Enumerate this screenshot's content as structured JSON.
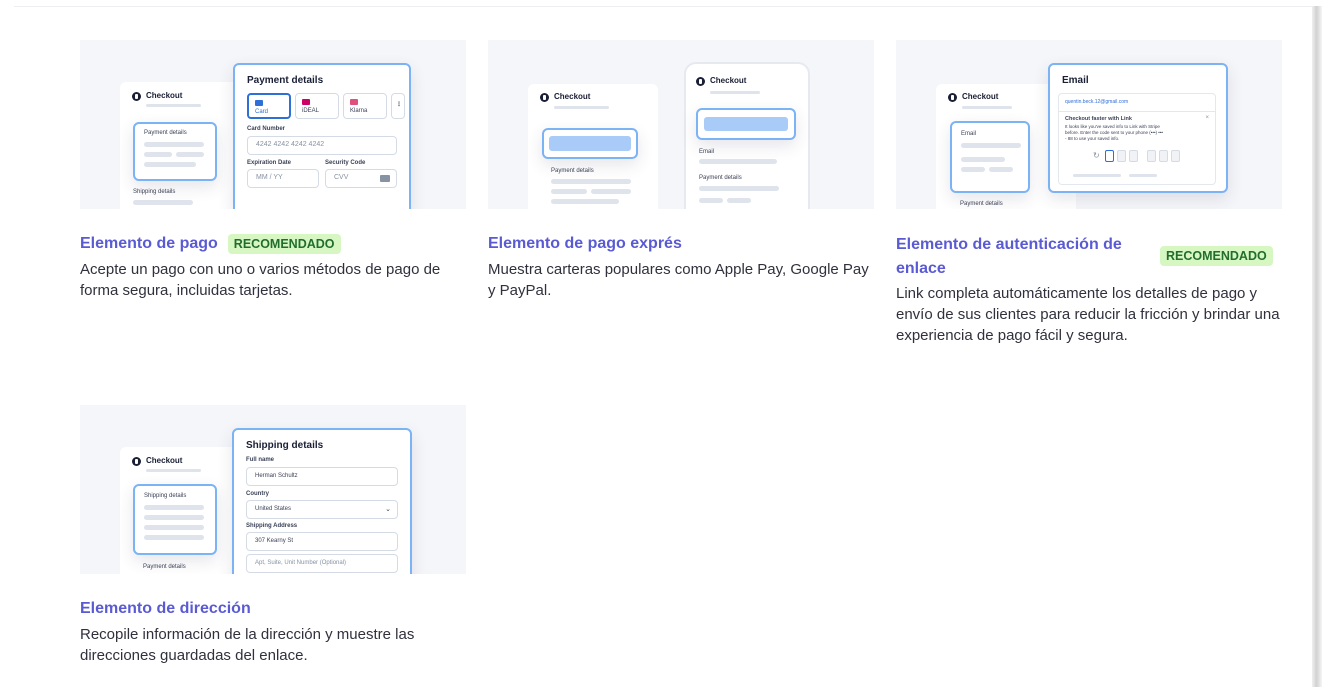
{
  "colors": {
    "title": "#5a5bd3",
    "badge_text": "#226d2d",
    "badge_bg": "#d7f7c2",
    "accent_blue": "#7cb3f5"
  },
  "cards": [
    {
      "title": "Elemento de pago",
      "badge": "RECOMENDADO",
      "description": "Acepte un pago con uno o varios métodos de pago de forma segura, incluidas tarjetas.",
      "preview": {
        "checkout": "Checkout",
        "section_payment": "Payment details",
        "section_shipping": "Shipping details",
        "panel_title": "Payment details",
        "tabs": [
          "Card",
          "iDEAL",
          "Klarna"
        ],
        "card_number_label": "Card Number",
        "card_number_value": "4242 4242 4242 4242",
        "expiration_label": "Expiration Date",
        "expiration_placeholder": "MM / YY",
        "security_label": "Security Code",
        "security_placeholder": "CVV"
      }
    },
    {
      "title": "Elemento de pago exprés",
      "description": "Muestra carteras populares como Apple Pay, Google Pay y PayPal.",
      "preview": {
        "checkout": "Checkout",
        "phone_checkout": "Checkout",
        "section_payment": "Payment details",
        "email_label": "Email",
        "phone_payment": "Payment details"
      }
    },
    {
      "title": "Elemento de autenticación de enlace",
      "badge": "RECOMENDADO",
      "description": "Link completa automáticamente los detalles de pago y envío de sus clientes para reducir la fricción y brindar una experiencia de pago fácil y segura.",
      "preview": {
        "checkout": "Checkout",
        "section_email": "Email",
        "section_payment": "Payment details",
        "panel_title": "Email",
        "email_value": "quentin.beck.12@gmail.com",
        "link_title": "Checkout faster with Link",
        "link_text_1": "It looks like you've saved info to Link with Stripe",
        "link_text_2": "before. Enter the code sent to your phone (•••) •••",
        "link_text_3": "- 88 to use your saved info."
      }
    },
    {
      "title": "Elemento de dirección",
      "description": "Recopile información de la dirección y muestre las direcciones guardadas del enlace.",
      "preview": {
        "checkout": "Checkout",
        "section_shipping": "Shipping details",
        "section_payment": "Payment details",
        "panel_title": "Shipping details",
        "full_name_label": "Full name",
        "full_name_value": "Herman Schultz",
        "country_label": "Country",
        "country_value": "United States",
        "address_label": "Shipping Address",
        "address_value": "307 Kearny St",
        "address2_placeholder": "Apt, Suite, Unit Number (Optional)"
      }
    }
  ]
}
